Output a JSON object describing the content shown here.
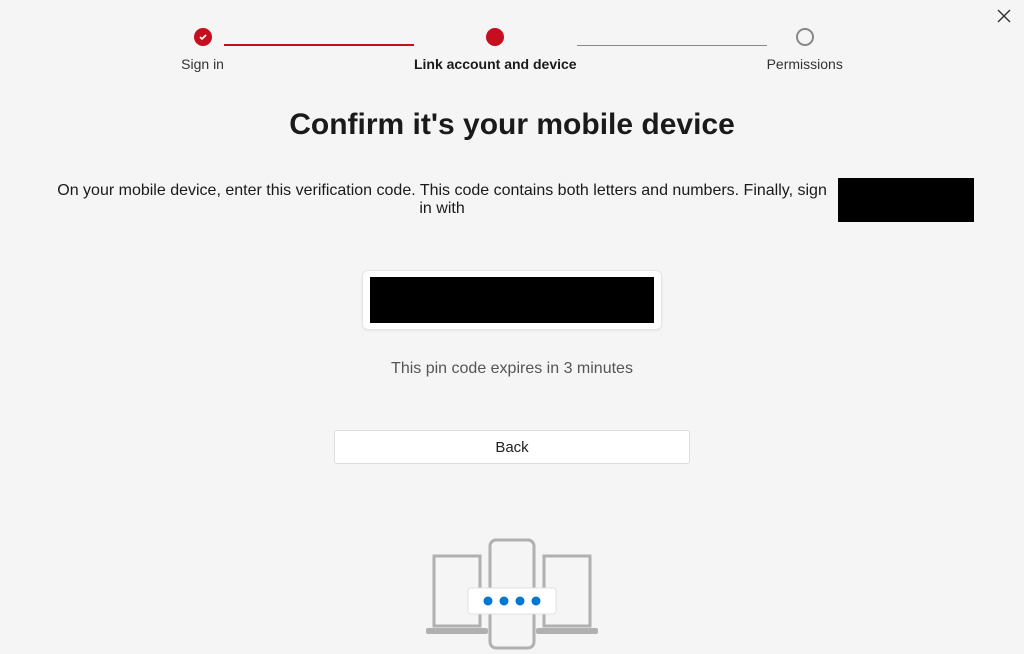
{
  "stepper": {
    "step1": {
      "label": "Sign in",
      "state": "done"
    },
    "step2": {
      "label": "Link account and device",
      "state": "active"
    },
    "step3": {
      "label": "Permissions",
      "state": "pending"
    }
  },
  "title": "Confirm it's your mobile device",
  "subtitle": "On your mobile device, enter this verification code. This code contains both letters and numbers. Finally, sign in with",
  "expiry": "This pin code expires in 3 minutes",
  "back_label": "Back",
  "colors": {
    "accent": "#c50f1f",
    "illustration_dot": "#0078d4"
  }
}
